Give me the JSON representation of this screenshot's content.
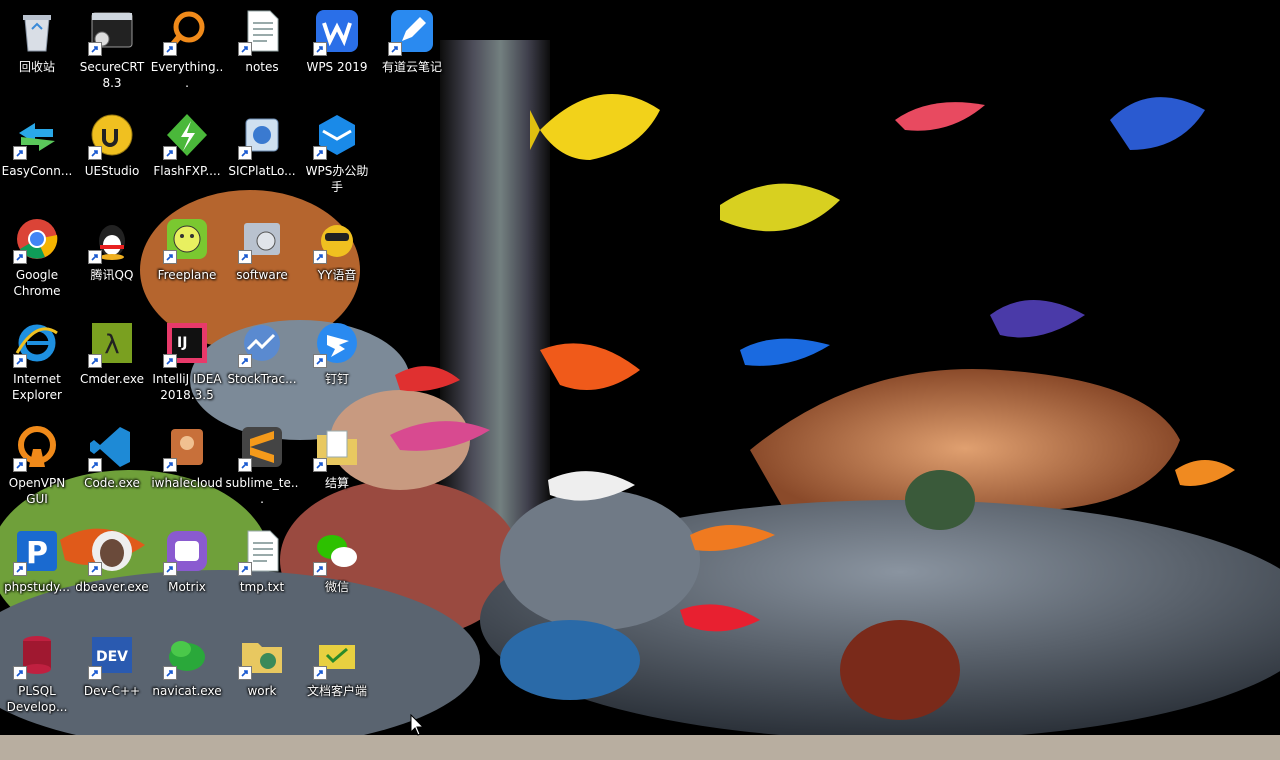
{
  "desktop": {
    "icons": [
      {
        "label": "回收站",
        "icon": "recycle-bin-icon",
        "shortcut": false,
        "col": 1,
        "row": 1
      },
      {
        "label": "SecureCRT 8.3",
        "icon": "securecrt-icon",
        "shortcut": true,
        "col": 2,
        "row": 1
      },
      {
        "label": "Everything...",
        "icon": "everything-search-icon",
        "shortcut": true,
        "col": 3,
        "row": 1
      },
      {
        "label": "notes",
        "icon": "text-file-icon",
        "shortcut": true,
        "col": 4,
        "row": 1
      },
      {
        "label": "WPS 2019",
        "icon": "wps-icon",
        "shortcut": true,
        "col": 5,
        "row": 1
      },
      {
        "label": "有道云笔记",
        "icon": "youdao-note-icon",
        "shortcut": true,
        "col": 6,
        "row": 1
      },
      {
        "label": "EasyConn...",
        "icon": "easyconnect-icon",
        "shortcut": true,
        "col": 1,
        "row": 2
      },
      {
        "label": "UEStudio",
        "icon": "uestudio-icon",
        "shortcut": true,
        "col": 2,
        "row": 2
      },
      {
        "label": "FlashFXP....",
        "icon": "flashfxp-icon",
        "shortcut": true,
        "col": 3,
        "row": 2
      },
      {
        "label": "SICPlatLo...",
        "icon": "sicplat-icon",
        "shortcut": true,
        "col": 4,
        "row": 2
      },
      {
        "label": "WPS办公助手",
        "icon": "wps-assistant-icon",
        "shortcut": true,
        "col": 5,
        "row": 2
      },
      {
        "label": "Google Chrome",
        "icon": "chrome-icon",
        "shortcut": true,
        "col": 1,
        "row": 3
      },
      {
        "label": "腾讯QQ",
        "icon": "qq-icon",
        "shortcut": true,
        "col": 2,
        "row": 3
      },
      {
        "label": "Freeplane",
        "icon": "freeplane-icon",
        "shortcut": true,
        "col": 3,
        "row": 3
      },
      {
        "label": "software",
        "icon": "software-folder-icon",
        "shortcut": true,
        "col": 4,
        "row": 3
      },
      {
        "label": "YY语音",
        "icon": "yy-icon",
        "shortcut": true,
        "col": 5,
        "row": 3
      },
      {
        "label": "Internet Explorer",
        "icon": "ie-icon",
        "shortcut": true,
        "col": 1,
        "row": 4
      },
      {
        "label": "Cmder.exe",
        "icon": "cmder-icon",
        "shortcut": true,
        "col": 2,
        "row": 4
      },
      {
        "label": "IntelliJ IDEA 2018.3.5",
        "icon": "intellij-icon",
        "shortcut": true,
        "col": 3,
        "row": 4
      },
      {
        "label": "StockTrac...",
        "icon": "stocktrac-icon",
        "shortcut": true,
        "col": 4,
        "row": 4
      },
      {
        "label": "钉钉",
        "icon": "dingtalk-icon",
        "shortcut": true,
        "col": 5,
        "row": 4
      },
      {
        "label": "OpenVPN GUI",
        "icon": "openvpn-icon",
        "shortcut": true,
        "col": 1,
        "row": 5
      },
      {
        "label": "Code.exe",
        "icon": "vscode-icon",
        "shortcut": true,
        "col": 2,
        "row": 5
      },
      {
        "label": "iwhalecloud",
        "icon": "iwhalecloud-icon",
        "shortcut": true,
        "col": 3,
        "row": 5
      },
      {
        "label": "sublime_te...",
        "icon": "sublime-icon",
        "shortcut": true,
        "col": 4,
        "row": 5
      },
      {
        "label": "结算",
        "icon": "folder-file-icon",
        "shortcut": true,
        "col": 5,
        "row": 5
      },
      {
        "label": "phpstudy...",
        "icon": "phpstudy-icon",
        "shortcut": true,
        "col": 1,
        "row": 6
      },
      {
        "label": "dbeaver.exe",
        "icon": "dbeaver-icon",
        "shortcut": true,
        "col": 2,
        "row": 6
      },
      {
        "label": "Motrix",
        "icon": "motrix-icon",
        "shortcut": true,
        "col": 3,
        "row": 6
      },
      {
        "label": "tmp.txt",
        "icon": "text-file-icon",
        "shortcut": true,
        "col": 4,
        "row": 6
      },
      {
        "label": "微信",
        "icon": "wechat-icon",
        "shortcut": true,
        "col": 5,
        "row": 6
      },
      {
        "label": "PLSQL Develop...",
        "icon": "plsql-icon",
        "shortcut": true,
        "col": 1,
        "row": 7
      },
      {
        "label": "Dev-C++",
        "icon": "devcpp-icon",
        "shortcut": true,
        "col": 2,
        "row": 7
      },
      {
        "label": "navicat.exe",
        "icon": "navicat-icon",
        "shortcut": true,
        "col": 3,
        "row": 7
      },
      {
        "label": "work",
        "icon": "work-folder-icon",
        "shortcut": true,
        "col": 4,
        "row": 7
      },
      {
        "label": "文档客户端",
        "icon": "doc-client-icon",
        "shortcut": true,
        "col": 5,
        "row": 7
      }
    ]
  },
  "wallpaper": {
    "icon": "aquarium-wallpaper",
    "colors": {
      "water": "#000000",
      "coral": "#c9774a",
      "rock": "#6d7a8a",
      "bubbles": "#9aa5b0"
    }
  },
  "cursor": {
    "icon": "arrow-cursor-icon"
  }
}
